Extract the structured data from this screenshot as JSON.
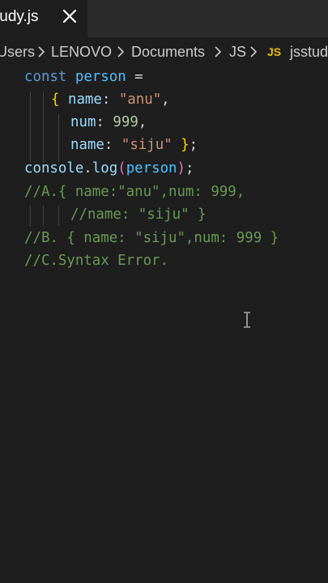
{
  "tab": {
    "filename": "tudy.js",
    "close_glyph": "✕"
  },
  "breadcrumb": {
    "items": [
      "Users",
      "LENOVO",
      "Documents",
      "JS",
      "jsstud"
    ],
    "js_badge": "JS"
  },
  "code": {
    "l1": {
      "kw": "const",
      "name": "person",
      "op": " ="
    },
    "l2": {
      "brace": "{",
      "prop": "name",
      "colon": ": ",
      "str": "\"anu\"",
      "comma": ","
    },
    "l3": {
      "prop": "num",
      "colon": ": ",
      "num": "999",
      "comma": ","
    },
    "l4": {
      "prop": "name",
      "colon": ": ",
      "str": "\"siju\"",
      "brace": " }",
      "semi": ";"
    },
    "l5": {
      "obj": "console",
      "dot": ".",
      "fn": "log",
      "paren_open": "(",
      "arg": "person",
      "paren_close": ")",
      "semi": ";"
    },
    "l6": "//A.{ name:\"anu\",num: 999,",
    "l7": "//name: \"siju\" }",
    "l8": "//B. { name: \"siju\",num: 999 }",
    "l9": "//C.Syntax Error."
  },
  "colors": {
    "background": "#1e1e1e",
    "keyword": "#569cd6",
    "variable": "#4fc1ff",
    "property": "#9cdcfe",
    "string": "#ce9178",
    "number": "#b5cea8",
    "comment": "#6a9955",
    "bracket": "#ffd700",
    "js_badge": "#e8c000"
  }
}
